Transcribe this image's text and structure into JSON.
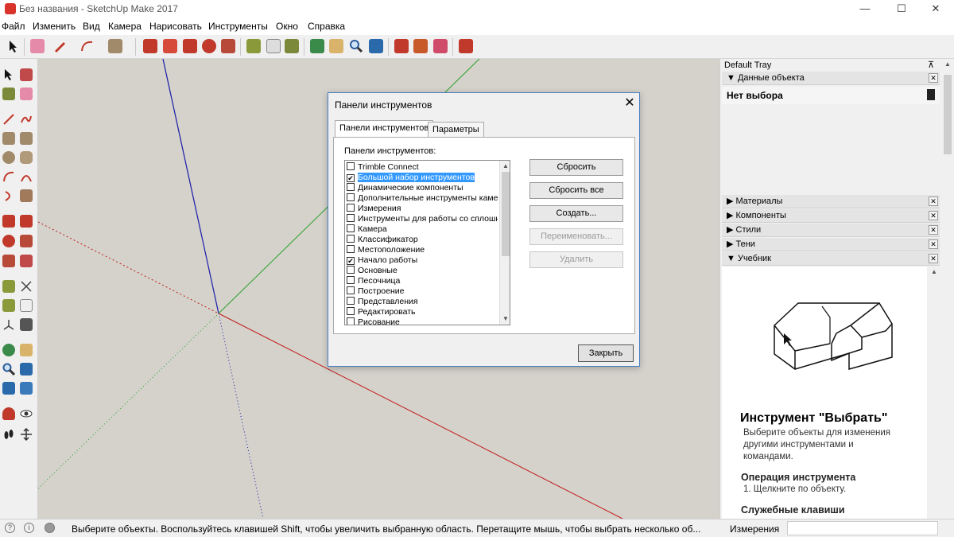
{
  "window": {
    "title": "Без названия - SketchUp Make 2017",
    "controls": [
      "—",
      "☐",
      "✕"
    ]
  },
  "menu": [
    "Файл",
    "Изменить",
    "Вид",
    "Камера",
    "Нарисовать",
    "Инструменты",
    "Окно",
    "Справка"
  ],
  "dialog": {
    "title": "Панели инструментов",
    "close": "✕",
    "tabs": [
      "Панели инструментов",
      "Параметры"
    ],
    "list_label": "Панели инструментов:",
    "items": [
      {
        "label": "Trimble Connect",
        "checked": false
      },
      {
        "label": "Большой набор инструментов",
        "checked": true,
        "selected": true
      },
      {
        "label": "Динамические компоненты",
        "checked": false
      },
      {
        "label": "Дополнительные инструменты каме",
        "checked": false
      },
      {
        "label": "Измерения",
        "checked": false
      },
      {
        "label": "Инструменты для работы со сплошн",
        "checked": false
      },
      {
        "label": "Камера",
        "checked": false
      },
      {
        "label": "Классификатор",
        "checked": false
      },
      {
        "label": "Местоположение",
        "checked": false
      },
      {
        "label": "Начало работы",
        "checked": true
      },
      {
        "label": "Основные",
        "checked": false
      },
      {
        "label": "Песочница",
        "checked": false
      },
      {
        "label": "Построение",
        "checked": false
      },
      {
        "label": "Представления",
        "checked": false
      },
      {
        "label": "Редактировать",
        "checked": false
      },
      {
        "label": "Рисование",
        "checked": false
      }
    ],
    "buttons": {
      "reset": "Сбросить",
      "reset_all": "Сбросить все",
      "create": "Создать...",
      "rename": "Переименовать...",
      "delete": "Удалить"
    },
    "close_button": "Закрыть"
  },
  "tray": {
    "title": "Default Tray",
    "pin": "⊼",
    "entity_section": "Данные объекта",
    "entity_value": "Нет выбора",
    "sections": [
      "Материалы",
      "Компоненты",
      "Стили",
      "Тени",
      "Учебник"
    ],
    "tutorial": {
      "heading": "Инструмент \"Выбрать\"",
      "description": "Выберите объекты для изменения другими инструментами и командами.",
      "operation_heading": "Операция инструмента",
      "step1": "1. Щелкните по объекту.",
      "keys_heading": "Служебные клавиши"
    }
  },
  "status": {
    "text": "Выберите объекты. Воспользуйтесь клавишей Shift, чтобы увеличить выбранную область. Перетащите мышь, чтобы выбрать несколько об...",
    "measure_label": "Измерения",
    "measure_value": ""
  },
  "colors": {
    "axis_blue": "#1a1aa8",
    "axis_red": "#c21a1a",
    "axis_green": "#2aa02a",
    "selection": "#3399ff",
    "viewport_bg": "#d4d2cb"
  }
}
